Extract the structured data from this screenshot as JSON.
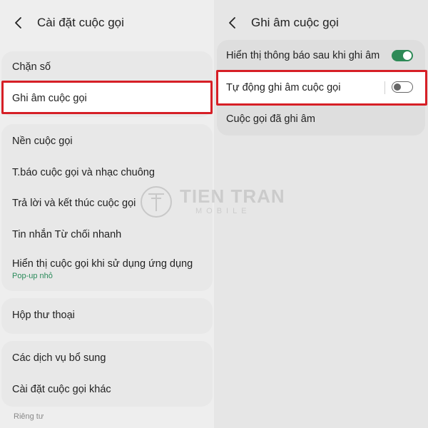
{
  "left_panel": {
    "title": "Cài đặt cuộc gọi",
    "items": {
      "block_numbers": "Chặn số",
      "call_recording": "Ghi âm cuộc gọi",
      "call_background": "Nền cuộc gọi",
      "call_alerts_ringtone": "T.báo cuộc gọi và nhạc chuông",
      "answer_end_calls": "Trả lời và kết thúc cuộc gọi",
      "quick_decline_messages": "Tin nhắn Từ chối nhanh",
      "show_calls_while_using_apps": "Hiển thị cuộc gọi khi sử dụng ứng dụng",
      "show_calls_sub": "Pop-up nhỏ",
      "voicemail": "Hộp thư thoại",
      "supplementary_services": "Các dịch vụ bổ sung",
      "other_call_settings": "Cài đặt cuộc gọi khác"
    },
    "section_privacy": "Riêng tư"
  },
  "right_panel": {
    "title": "Ghi âm cuộc gọi",
    "items": {
      "show_notification_after_recording": "Hiển thị thông báo sau khi ghi âm",
      "auto_record_calls": "Tự động ghi âm cuộc gọi",
      "recorded_calls": "Cuộc gọi đã ghi âm"
    },
    "toggles": {
      "show_notification_on": true,
      "auto_record_on": false
    }
  },
  "colors": {
    "accent_green": "#2e8a57",
    "highlight_red": "#d61f26"
  },
  "icons": {
    "back": "chevron-left-icon",
    "watermark_logo": "tien-tran-logo-icon"
  },
  "watermark": {
    "brand": "TIEN TRAN",
    "sub": "MOBILE"
  }
}
